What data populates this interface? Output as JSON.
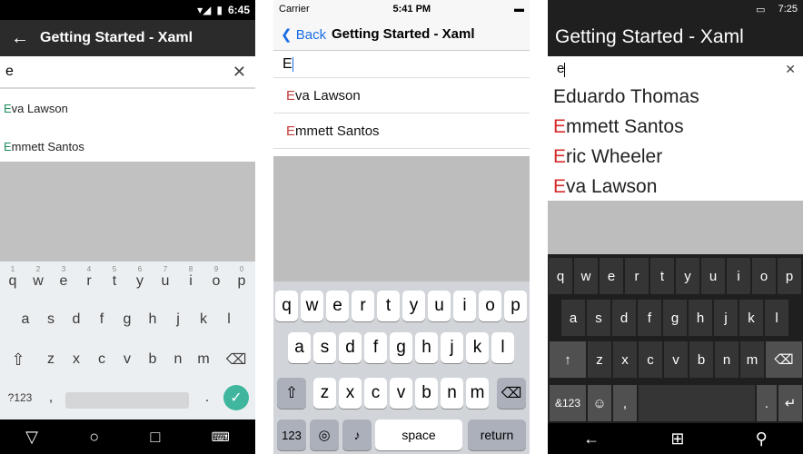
{
  "app": {
    "title": "Getting Started - Xaml"
  },
  "android": {
    "time": "6:45",
    "search_value": "e",
    "items": [
      {
        "first": "E",
        "rest": "va Lawson"
      },
      {
        "first": "E",
        "rest": "mmett Santos"
      }
    ],
    "row1": [
      "q",
      "w",
      "e",
      "r",
      "t",
      "y",
      "u",
      "i",
      "o",
      "p"
    ],
    "row1_hints": [
      "1",
      "2",
      "3",
      "4",
      "5",
      "6",
      "7",
      "8",
      "9",
      "0"
    ],
    "row2": [
      "a",
      "s",
      "d",
      "f",
      "g",
      "h",
      "j",
      "k",
      "l"
    ],
    "row3": [
      "z",
      "x",
      "c",
      "v",
      "b",
      "n",
      "m"
    ],
    "sym_label": "?123",
    "comma": ",",
    "period": "."
  },
  "ios": {
    "carrier": "Carrier",
    "time": "5:41 PM",
    "back_label": "Back",
    "search_value": "E",
    "items": [
      {
        "first": "E",
        "rest": "va Lawson"
      },
      {
        "first": "E",
        "rest": "mmett Santos"
      }
    ],
    "row1": [
      "q",
      "w",
      "e",
      "r",
      "t",
      "y",
      "u",
      "i",
      "o",
      "p"
    ],
    "row2": [
      "a",
      "s",
      "d",
      "f",
      "g",
      "h",
      "j",
      "k",
      "l"
    ],
    "row3": [
      "z",
      "x",
      "c",
      "v",
      "b",
      "n",
      "m"
    ],
    "num_label": "123",
    "space_label": "space",
    "return_label": "return"
  },
  "windows": {
    "time": "7:25",
    "search_value": "e",
    "items": [
      {
        "first": "",
        "rest": "Eduardo Thomas"
      },
      {
        "first": "E",
        "rest": "mmett Santos"
      },
      {
        "first": "E",
        "rest": "ric Wheeler"
      },
      {
        "first": "E",
        "rest": "va Lawson"
      }
    ],
    "row1": [
      "q",
      "w",
      "e",
      "r",
      "t",
      "y",
      "u",
      "i",
      "o",
      "p"
    ],
    "row2": [
      "a",
      "s",
      "d",
      "f",
      "g",
      "h",
      "j",
      "k",
      "l"
    ],
    "row3": [
      "z",
      "x",
      "c",
      "v",
      "b",
      "n",
      "m"
    ],
    "sym_label": "&123",
    "comma": ",",
    "period": "."
  },
  "colors": {
    "android_accent": "#3fb69d",
    "ios_accent": "#1a6de6",
    "windows_highlight": "#d42b2b"
  }
}
